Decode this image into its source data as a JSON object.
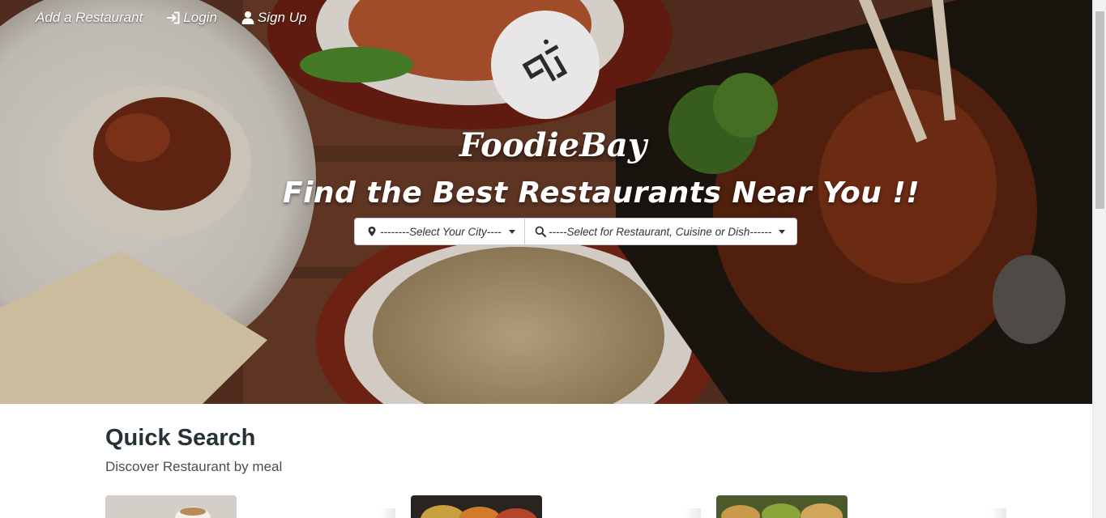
{
  "nav": {
    "add_restaurant": "Add a Restaurant",
    "login": "Login",
    "signup": "Sign Up"
  },
  "brand": {
    "name": "FoodieBay",
    "tagline": "Find the Best Restaurants Near You !!"
  },
  "search": {
    "city_label": "--------Select Your City----",
    "dish_label": "-----Select for Restaurant, Cuisine or Dish------"
  },
  "quick_search": {
    "title": "Quick Search",
    "subtitle": "Discover Restaurant by meal"
  },
  "icons": {
    "login": "sign-in-icon",
    "signup": "user-icon",
    "city": "map-marker-icon",
    "dish": "search-icon"
  },
  "colors": {
    "heading": "#263238",
    "subtext": "#444f55",
    "logo_bg": "#e8e6e6"
  }
}
